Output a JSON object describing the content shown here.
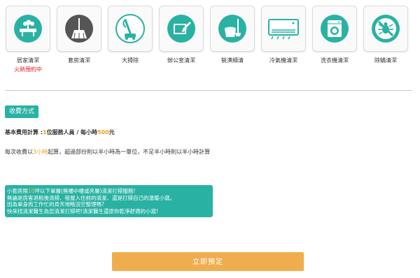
{
  "services": [
    {
      "label": "居家清潔",
      "badge": "火熱預約中",
      "icon": "home-cleaning-icon"
    },
    {
      "label": "套房清潔",
      "icon": "broom-icon"
    },
    {
      "label": "大掃除",
      "icon": "vacuum-icon"
    },
    {
      "label": "辦公室清潔",
      "icon": "squeegee-icon"
    },
    {
      "label": "裝潢細清",
      "icon": "renovation-cleaning-icon"
    },
    {
      "label": "冷氣機清潔",
      "icon": "air-conditioner-icon"
    },
    {
      "label": "洗衣機清潔",
      "icon": "washing-machine-icon"
    },
    {
      "label": "除蟎清潔",
      "icon": "no-mites-icon"
    }
  ],
  "fee": {
    "tag": "收費方式",
    "basic_prefix": "基本費用計算 :",
    "basic_workers": "1",
    "basic_mid": "位服務人員 / 每小時",
    "basic_price": "500",
    "basic_suffix": "元",
    "rule_prefix": "每次收費以",
    "rule_hours": "3小時",
    "rule_suffix": "起算，超過部份則以半小時為一單位，不足半小時則以半小時計算"
  },
  "note": {
    "line1_prefix": "小套房限",
    "line1_size": "10",
    "line1_suffix": "坪以下單層(無樓中樓或夾層)清潔打掃服務!",
    "line2": "無論是房客退租後清掃、租屋入住前的清潔、還是打掃自己的溫暖小窩。",
    "line3": "因為單身而工作忙的肯天地略沒空整理嗎?",
    "line4": "快來找清潔醫生為您清潔打掃吧!清潔醫生還原你乾淨舒適的小窩!"
  },
  "cta": {
    "label": "立即預定"
  },
  "colors": {
    "teal": "#29b2a3",
    "orange": "#f0ad4e",
    "highlight": "#f0a11c",
    "badge_red": "#e02020"
  }
}
